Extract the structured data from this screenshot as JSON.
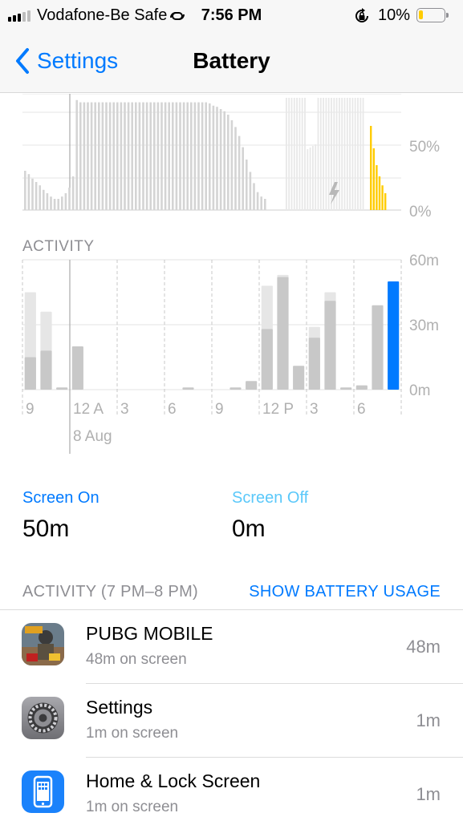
{
  "status_bar": {
    "carrier": "Vodafone-Be Safe",
    "time": "7:56 PM",
    "battery_percent": "10%",
    "signal_bars_filled": 3,
    "signal_bars_total": 5,
    "icons": [
      "signal-icon",
      "wifi-calling-icon",
      "rotation-lock-icon",
      "battery-icon"
    ]
  },
  "nav": {
    "back_label": "Settings",
    "title": "Battery"
  },
  "battery_chart": {
    "type": "bar",
    "yticks": [
      "50%",
      "0%"
    ],
    "icons": [
      "charging-bolt-icon"
    ],
    "colors": {
      "history": "#d4d4d4",
      "charging": "#e8e8e8",
      "current": "#ffcc00"
    }
  },
  "activity_chart_label": "ACTIVITY",
  "chart_data": [
    {
      "type": "bar",
      "title": "",
      "ylabel": "",
      "yticks": [
        "60m",
        "30m",
        "0m"
      ],
      "ylim": [
        0,
        60
      ],
      "xticks": [
        "9",
        "12 A",
        "3",
        "6",
        "9",
        "12 P",
        "3",
        "6"
      ],
      "x_sublabel": "8 Aug",
      "series": [
        {
          "values": [
            15,
            18,
            1,
            20,
            0,
            0,
            0,
            0,
            0,
            0,
            1,
            0,
            0,
            1,
            4,
            28,
            52,
            11,
            24,
            41,
            1,
            2,
            39,
            50
          ]
        },
        {
          "values": [
            45,
            36,
            1,
            20,
            0,
            0,
            0,
            0,
            0,
            0,
            1,
            0,
            0,
            1,
            4,
            48,
            53,
            11,
            29,
            45,
            1,
            2,
            39,
            50
          ]
        }
      ],
      "colors": {
        "screen_on": "#c8c8c8",
        "screen_off": "#e6e6e6",
        "current_hour": "#007aff"
      }
    }
  ],
  "screen_on": {
    "label": "Screen On",
    "value": "50m"
  },
  "screen_off": {
    "label": "Screen Off",
    "value": "0m"
  },
  "activity_list": {
    "header": "ACTIVITY (7 PM–8 PM)",
    "action": "SHOW BATTERY USAGE",
    "apps": [
      {
        "name": "PUBG MOBILE",
        "sub": "48m on screen",
        "time": "48m",
        "icon": "pubg-app-icon"
      },
      {
        "name": "Settings",
        "sub": "1m on screen",
        "time": "1m",
        "icon": "settings-gear-icon"
      },
      {
        "name": "Home & Lock Screen",
        "sub": "1m on screen",
        "time": "1m",
        "icon": "phone-icon"
      }
    ]
  },
  "colors": {
    "accent": "#007aff",
    "screen_on_label": "#007aff",
    "screen_off_label": "#5ac8fa"
  }
}
